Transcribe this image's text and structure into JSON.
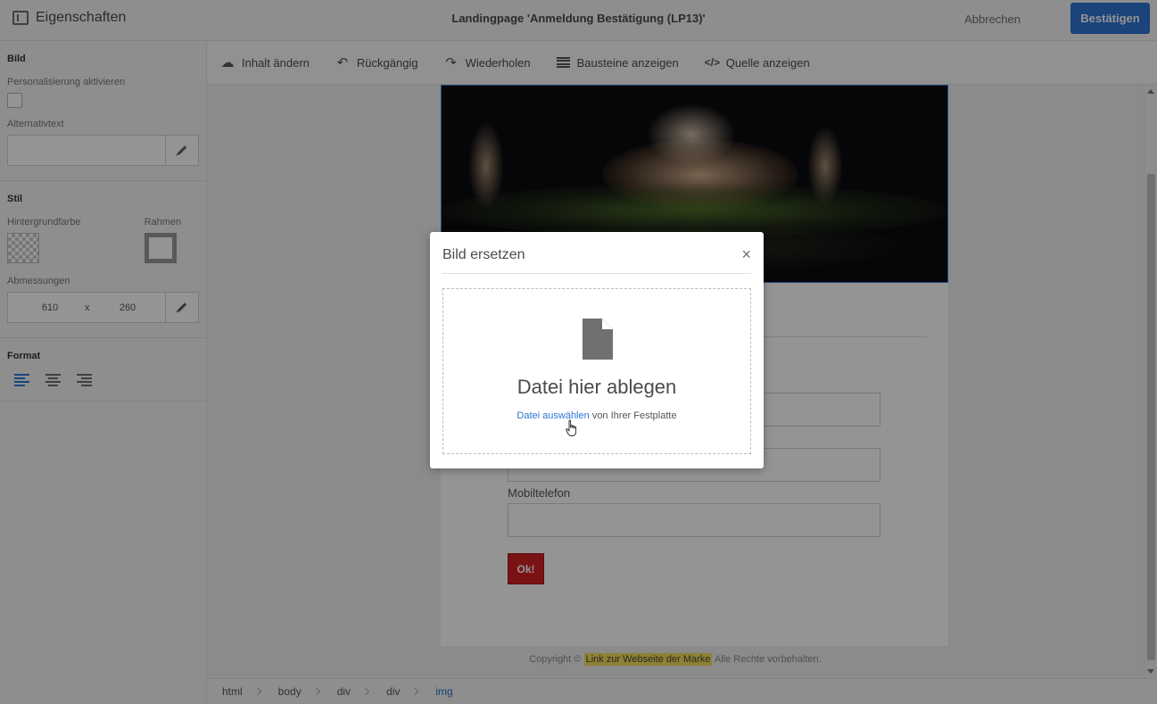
{
  "topbar": {
    "panel_label": "Eigenschaften",
    "title": "Landingpage 'Anmeldung Bestätigung (LP13)'",
    "cancel_label": "Abbrechen",
    "confirm_label": "Bestätigen"
  },
  "leftpanel": {
    "image_section": {
      "title": "Bild",
      "personalization_label": "Personalisierung aktivieren",
      "alt_text_label": "Alternativtext",
      "alt_text_value": ""
    },
    "style_section": {
      "title": "Stil",
      "bg_color_label": "Hintergrundfarbe",
      "border_label": "Rahmen",
      "dimensions_label": "Abmessungen",
      "width": "610",
      "separator": "x",
      "height": "260"
    },
    "format_section": {
      "title": "Format"
    }
  },
  "toolbar": {
    "items": [
      {
        "label": "Inhalt ändern",
        "icon": "cloud-upload-icon"
      },
      {
        "label": "Rückgängig",
        "icon": "undo-icon"
      },
      {
        "label": "Wiederholen",
        "icon": "redo-icon"
      },
      {
        "label": "Bausteine anzeigen",
        "icon": "blocks-icon"
      },
      {
        "label": "Quelle anzeigen",
        "icon": "code-icon"
      }
    ]
  },
  "page": {
    "mobile_label": "Mobiltelefon",
    "ok_label": "Ok!",
    "copyright_prefix": "Copyright ©",
    "copyright_link": "Link zur Webseite der Marke",
    "copyright_suffix": "Alle Rechte vorbehalten."
  },
  "breadcrumb": [
    "html",
    "body",
    "div",
    "div",
    "img"
  ],
  "dialog": {
    "title": "Bild ersetzen",
    "close": "×",
    "drop_title": "Datei hier ablegen",
    "choose_link": "Datei auswählen",
    "choose_suffix": "von Ihrer Festplatte"
  },
  "colors": {
    "accent": "#2d75d2",
    "ok_button": "#d31f24",
    "highlight": "#f5de5b"
  }
}
